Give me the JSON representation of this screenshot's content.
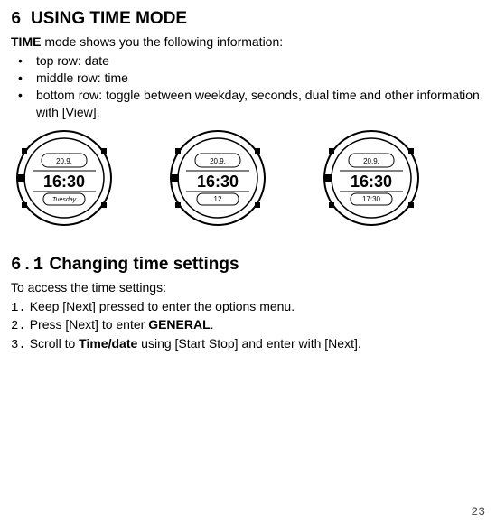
{
  "section": {
    "number": "6",
    "title": "USING TIME MODE"
  },
  "intro": {
    "label": "TIME",
    "rest": " mode shows you the following information:"
  },
  "bullets": [
    "top row: date",
    "middle row: time",
    "bottom row: toggle between weekday, seconds, dual time and other information with [View]."
  ],
  "watches": [
    {
      "date": "20.9.",
      "time": "16:30",
      "bottom": "Tuesday"
    },
    {
      "date": "20.9.",
      "time": "16:30",
      "bottom": "12"
    },
    {
      "date": "20.9.",
      "time": "16:30",
      "bottom": "17:30"
    }
  ],
  "subsection": {
    "number": "6.1",
    "title": "Changing time settings"
  },
  "access_line": "To access the time settings:",
  "steps": [
    {
      "n": "1.",
      "before": "Keep [Next] pressed to enter the options menu.",
      "bold": "",
      "after": ""
    },
    {
      "n": "2.",
      "before": "Press [Next] to enter ",
      "bold": "GENERAL",
      "after": "."
    },
    {
      "n": "3.",
      "before": "Scroll to ",
      "bold": "Time/date",
      "after": " using [Start Stop] and enter with [Next]."
    }
  ],
  "page": "23"
}
